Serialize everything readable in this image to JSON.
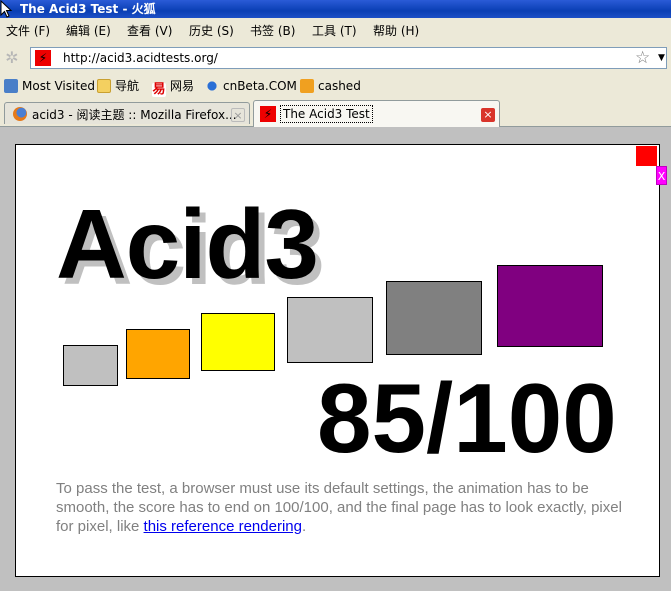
{
  "window": {
    "title": "The Acid3 Test - 火狐"
  },
  "menu": [
    "文件 (F)",
    "编辑 (E)",
    "查看 (V)",
    "历史 (S)",
    "书签 (B)",
    "工具 (T)",
    "帮助 (H)"
  ],
  "urlbar": {
    "url": "http://acid3.acidtests.org/"
  },
  "bookmarks": [
    "Most Visited",
    "导航",
    "网易",
    "cnBeta.COM",
    "cashed"
  ],
  "tabs": [
    {
      "label": "acid3 - 阅读主题 :: Mozilla Firefox...",
      "close": "×"
    },
    {
      "label": "The Acid3 Test",
      "close": "×"
    }
  ],
  "page": {
    "title": "Acid3",
    "score": "85/100",
    "x_marker": "X",
    "desc_before": "To pass the test, a browser must use its default settings, the animation has to be smooth, the score has to end on 100/100, and the final page has to look exactly, pixel for pixel, like ",
    "link_text": "this reference rendering",
    "desc_after": "."
  },
  "colors": {
    "bucket1": "#c0c0c0",
    "bucket2": "#ffa500",
    "bucket3": "#ffff00",
    "bucket4": "#c0c0c0",
    "bucket5": "#808080",
    "bucket6": "#800080",
    "status_red": "#ff0000",
    "x_marker": "#ff00ff"
  }
}
